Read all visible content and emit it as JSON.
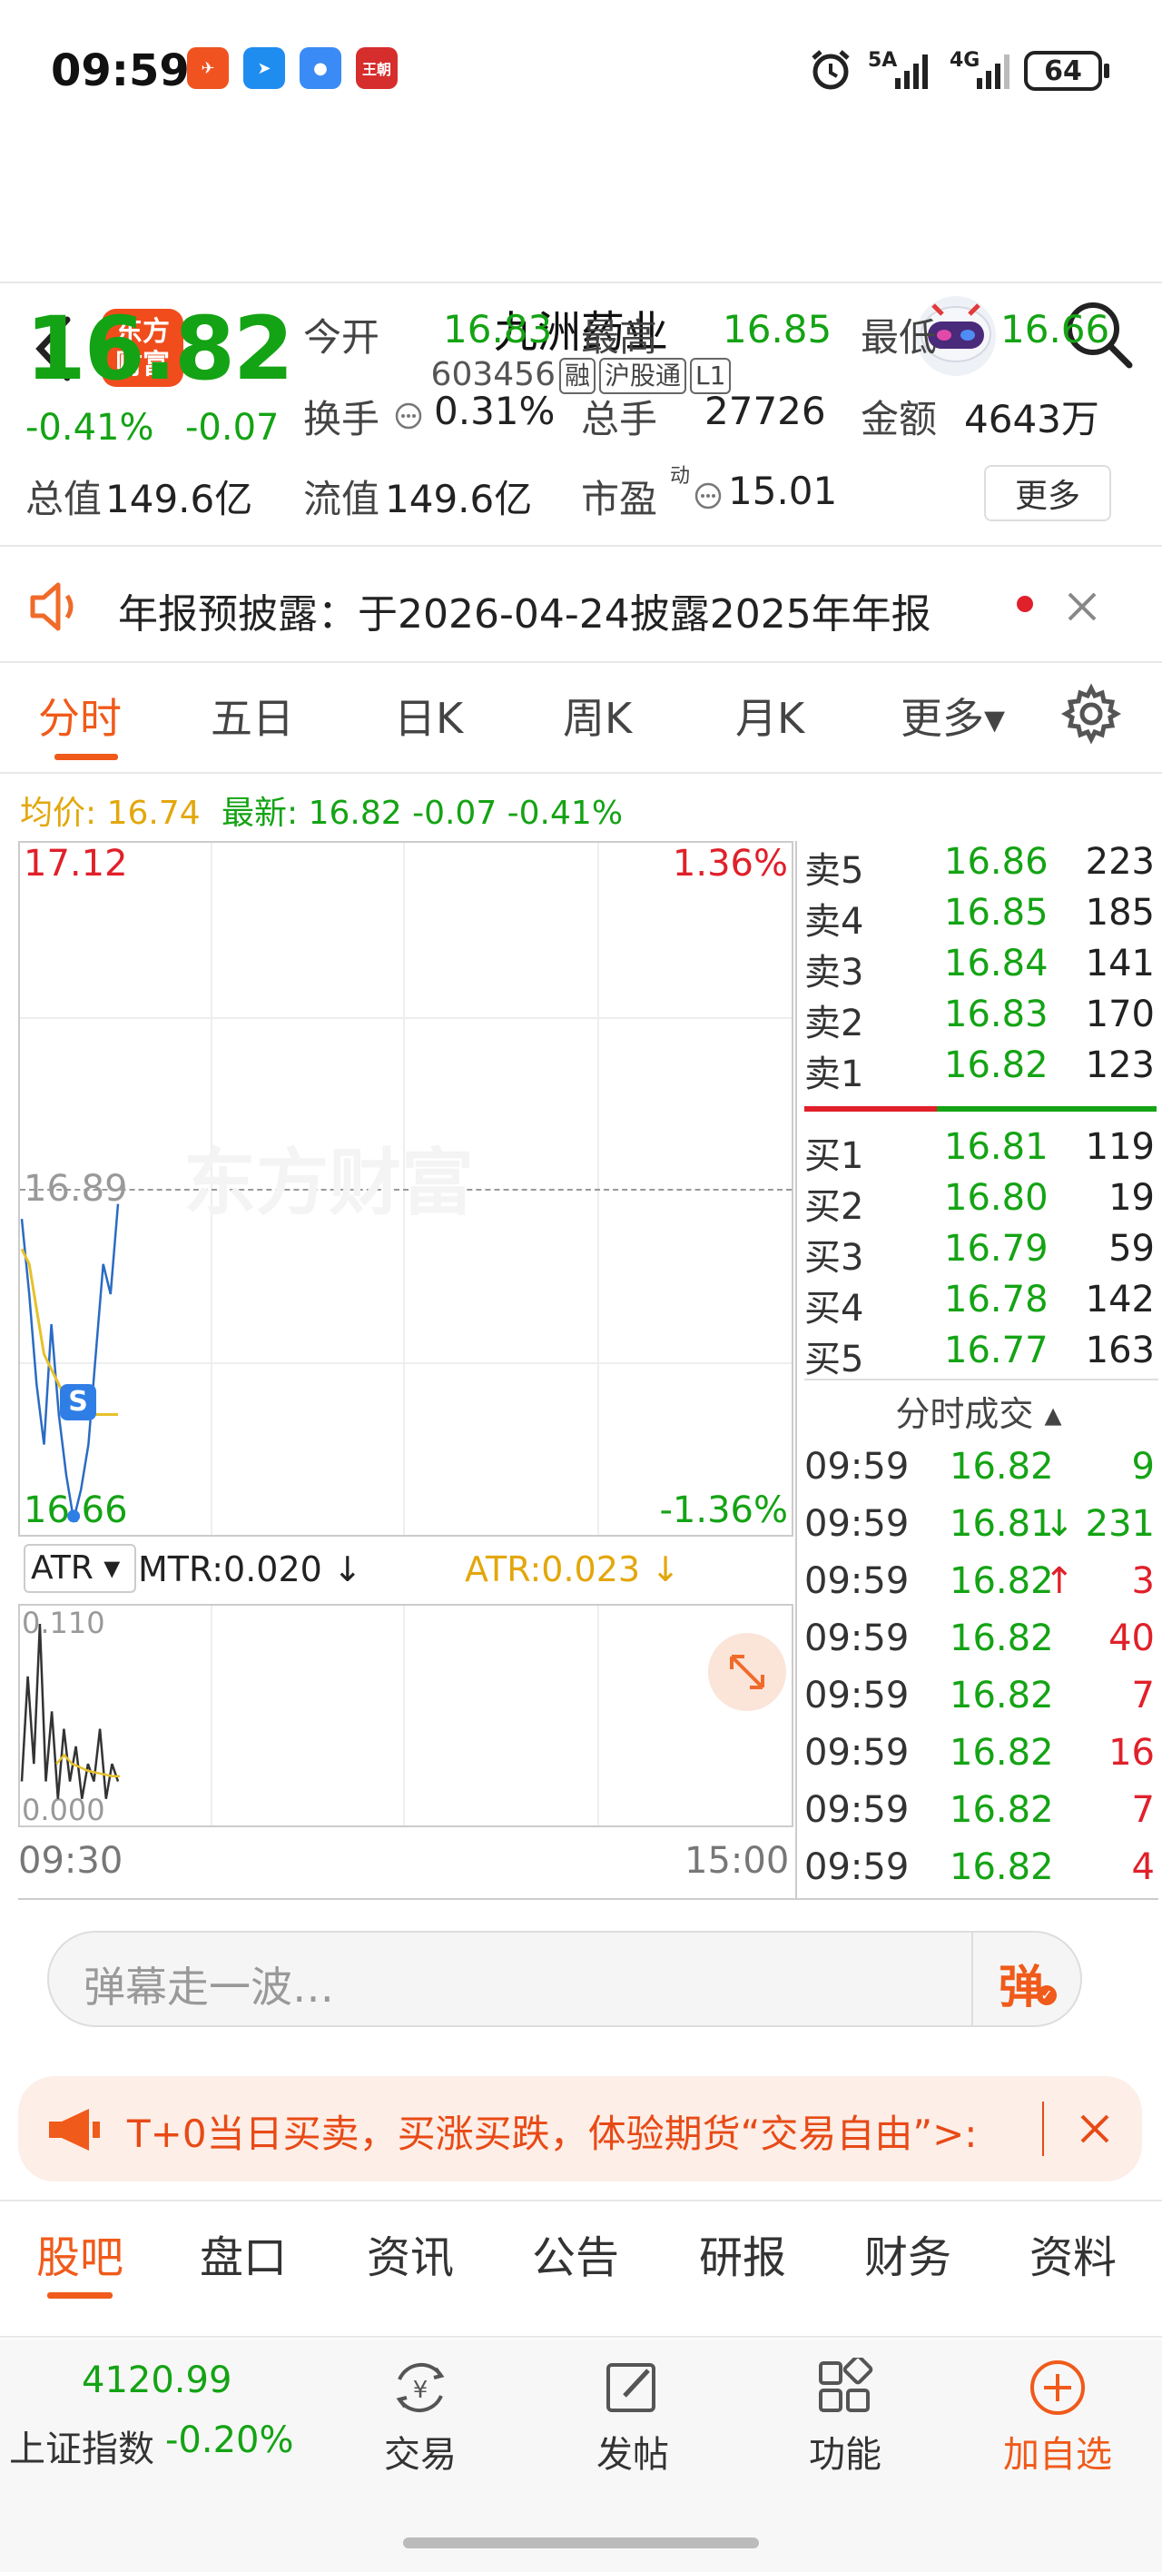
{
  "status_bar": {
    "time": "09:59",
    "app_icons": [
      {
        "name": "app-icon-1",
        "color": "#f0531f",
        "glyph": "✈"
      },
      {
        "name": "app-icon-2",
        "color": "#1f8df0",
        "glyph": "➤"
      },
      {
        "name": "app-icon-3",
        "color": "#3a8bf5",
        "glyph": "●"
      },
      {
        "name": "app-icon-4",
        "color": "#d62d2d",
        "glyph": "王朝"
      }
    ],
    "network_1": "5A",
    "network_2": "4G",
    "battery": "64"
  },
  "header": {
    "back_icon": "chevron-left-icon",
    "logo_text_1": "东方",
    "logo_text_2": "财富",
    "stock_name": "九洲药业",
    "stock_code": "603456",
    "tags": [
      "融",
      "沪股通",
      "L1"
    ]
  },
  "quote": {
    "price": "16.82",
    "change_pct": "-0.41%",
    "change": "-0.07",
    "open_label": "今开",
    "open": "16.83",
    "high_label": "最高",
    "high": "16.85",
    "low_label": "最低",
    "low": "16.66",
    "turnover_label": "换手",
    "turnover": "0.31%",
    "volume_label": "总手",
    "volume": "27726",
    "amount_label": "金额",
    "amount": "4643万",
    "market_cap_label": "总值",
    "market_cap": "149.6亿",
    "float_cap_label": "流值",
    "float_cap": "149.6亿",
    "pe_label": "市盈",
    "pe_sup": "动",
    "pe": "15.01",
    "more_label": "更多"
  },
  "notice": {
    "text": "年报预披露：于2026-04-24披露2025年年报"
  },
  "chart_tabs": {
    "items": [
      "分时",
      "五日",
      "日K",
      "周K",
      "月K",
      "更多▾"
    ],
    "active": "分时"
  },
  "info_line": {
    "avg_label": "均价: 16.74",
    "latest_label": "最新: 16.82 -0.07 -0.41%"
  },
  "chart": {
    "top_price": "17.12",
    "top_pct": "1.36%",
    "mid_price": "16.89",
    "bottom_price": "16.66",
    "bottom_pct": "-1.36%",
    "watermark": "东方财富",
    "marker": "S",
    "time_start": "09:30",
    "time_end": "15:00"
  },
  "chart_data": {
    "type": "line",
    "x_range": [
      "09:30",
      "15:00"
    ],
    "ylim": [
      16.66,
      17.12
    ],
    "series": [
      {
        "color": "#2a6bc4",
        "values": [
          16.87,
          16.82,
          16.76,
          16.72,
          16.8,
          16.74,
          16.7,
          16.67,
          16.69,
          16.72,
          16.78,
          16.84,
          16.82,
          16.88
        ]
      },
      {
        "color": "#e7c12a",
        "values": [
          16.85,
          16.84,
          16.81,
          16.78,
          16.77,
          16.76,
          16.75,
          16.74,
          16.74,
          16.74,
          16.74,
          16.74,
          16.74,
          16.74
        ]
      }
    ]
  },
  "indicator": {
    "name": "ATR ▾",
    "mtr": "MTR:0.020",
    "atr": "ATR:0.023",
    "top_val": "0.110",
    "bottom_val": "0.000",
    "mtr_values": [
      0.02,
      0.08,
      0.03,
      0.11,
      0.02,
      0.06,
      0.01,
      0.05,
      0.02,
      0.04,
      0.01,
      0.03,
      0.02,
      0.05,
      0.01,
      0.03,
      0.02
    ],
    "atr_values": [
      0.03,
      0.035,
      0.03,
      0.028,
      0.026,
      0.025,
      0.024,
      0.023,
      0.023
    ]
  },
  "order_book": {
    "sells": [
      {
        "label": "卖5",
        "price": "16.86",
        "vol": "223"
      },
      {
        "label": "卖4",
        "price": "16.85",
        "vol": "185"
      },
      {
        "label": "卖3",
        "price": "16.84",
        "vol": "141"
      },
      {
        "label": "卖2",
        "price": "16.83",
        "vol": "170"
      },
      {
        "label": "卖1",
        "price": "16.82",
        "vol": "123"
      }
    ],
    "buys": [
      {
        "label": "买1",
        "price": "16.81",
        "vol": "119"
      },
      {
        "label": "买2",
        "price": "16.80",
        "vol": "19"
      },
      {
        "label": "买3",
        "price": "16.79",
        "vol": "59"
      },
      {
        "label": "买4",
        "price": "16.78",
        "vol": "142"
      },
      {
        "label": "买5",
        "price": "16.77",
        "vol": "163"
      }
    ],
    "ticks_header": "分时成交 ▴",
    "ticks": [
      {
        "time": "09:59",
        "price": "16.82",
        "arrow": "",
        "vol": "9",
        "vol_color": "#14a314"
      },
      {
        "time": "09:59",
        "price": "16.81",
        "arrow": "↓",
        "vol": "231",
        "vol_color": "#14a314"
      },
      {
        "time": "09:59",
        "price": "16.82",
        "arrow": "↑",
        "vol": "3",
        "vol_color": "#e0202a"
      },
      {
        "time": "09:59",
        "price": "16.82",
        "arrow": "",
        "vol": "40",
        "vol_color": "#e0202a"
      },
      {
        "time": "09:59",
        "price": "16.82",
        "arrow": "",
        "vol": "7",
        "vol_color": "#e0202a"
      },
      {
        "time": "09:59",
        "price": "16.82",
        "arrow": "",
        "vol": "16",
        "vol_color": "#e0202a"
      },
      {
        "time": "09:59",
        "price": "16.82",
        "arrow": "",
        "vol": "7",
        "vol_color": "#e0202a"
      },
      {
        "time": "09:59",
        "price": "16.82",
        "arrow": "",
        "vol": "4",
        "vol_color": "#e0202a"
      }
    ]
  },
  "danmu": {
    "placeholder": "弹幕走一波…",
    "button": "弹"
  },
  "promo": {
    "text": "T+0当日买卖，买涨买跌，体验期货“交易自由”>:"
  },
  "bottom_tabs": {
    "items": [
      "股吧",
      "盘口",
      "资讯",
      "公告",
      "研报",
      "财务",
      "资料"
    ],
    "active": "股吧"
  },
  "footer": {
    "index_value": "4120.99",
    "index_name": "上证指数",
    "index_change": "-0.20%",
    "trade_label": "交易",
    "post_label": "发帖",
    "func_label": "功能",
    "add_label": "加自选"
  }
}
